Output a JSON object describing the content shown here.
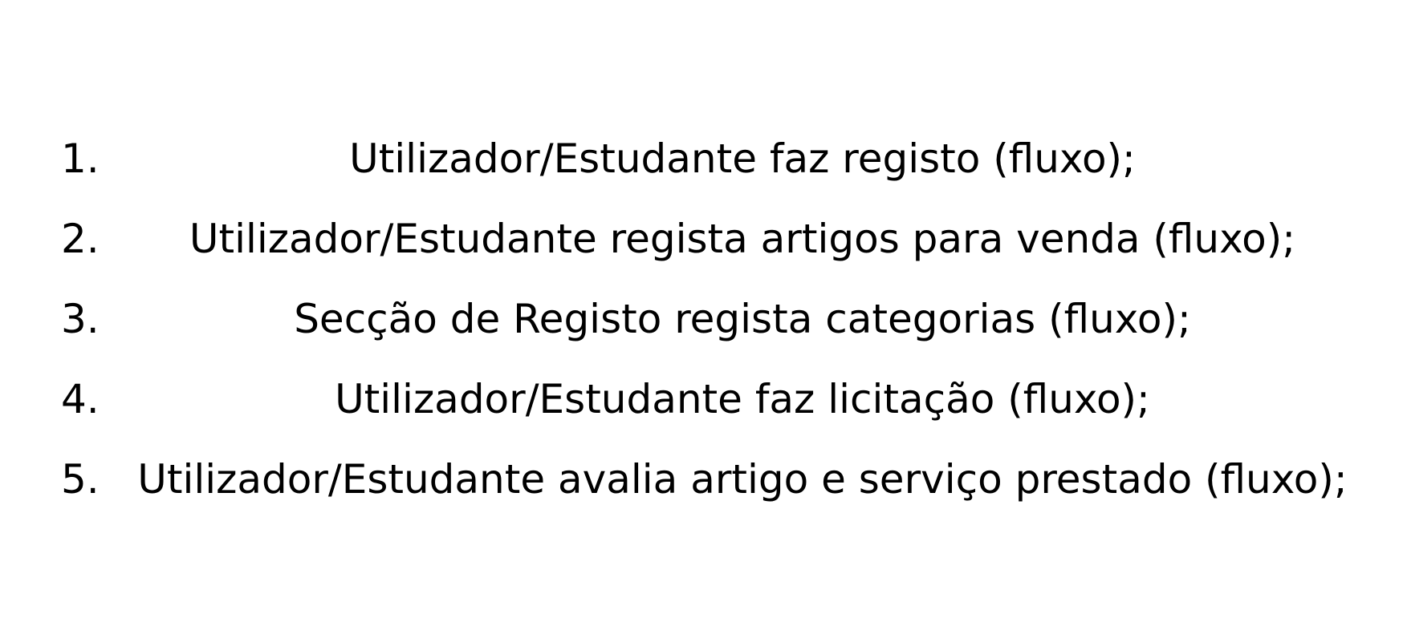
{
  "items": [
    {
      "number": "1.",
      "text": "Utilizador/Estudante faz registo (fluxo);"
    },
    {
      "number": "2.",
      "text": "Utilizador/Estudante regista artigos para venda (fluxo);"
    },
    {
      "number": "3.",
      "text": "Secção de Registo regista categorias (fluxo);"
    },
    {
      "number": "4.",
      "text": "Utilizador/Estudante faz licitação (fluxo);"
    },
    {
      "number": "5.",
      "text": "Utilizador/Estudante avalia artigo e serviço prestado (fluxo);"
    }
  ]
}
